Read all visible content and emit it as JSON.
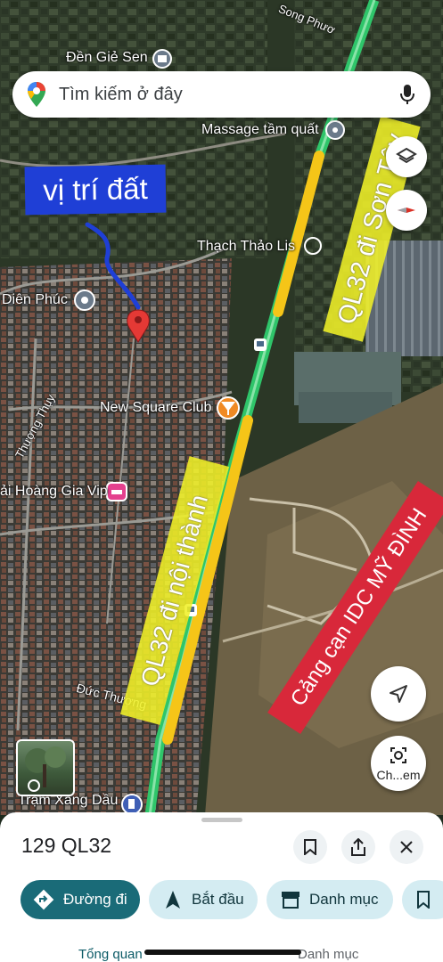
{
  "search": {
    "placeholder": "Tìm kiếm ở đây"
  },
  "places": {
    "den_gie_sen": "Đền Giẻ Sen",
    "song_phuong": "Song Phươ",
    "massage": "Massage tầm quất",
    "thach_thao": "Thạch Thảo Lis",
    "dien_phuc": "Diên Phúc",
    "new_square": "New Square Club",
    "thuong_thuy": "Thượng Thụy",
    "hoang_gia": "ải Hoàng Gia Vip",
    "duc_thuong": "Đức Thượng",
    "tram_xang": "Trạm Xăng Dầu"
  },
  "annotations": {
    "vi_tri_dat": "vị trí đất",
    "ql32_son_tay": "QL32 đi Sơn Tây",
    "ql32_noi_thanh": "QL32 đi nội thành",
    "cang_can": "Cảng cạn IDC MỸ ĐÌNH"
  },
  "streetview_label": "Ch...em",
  "sheet": {
    "title": "129 QL32",
    "directions_label": "Đường đi",
    "start_label": "Bắt đầu",
    "catalog_label": "Danh mục",
    "tab_overview": "Tổng quan",
    "tab_catalog": "Danh mục"
  },
  "colors": {
    "highway": "#2fc56a",
    "highlight": "#f5c518",
    "blue_label": "#1f3fd6",
    "red_label": "#d8283a",
    "pin": "#e53935",
    "accent_button": "#1a6b78"
  }
}
